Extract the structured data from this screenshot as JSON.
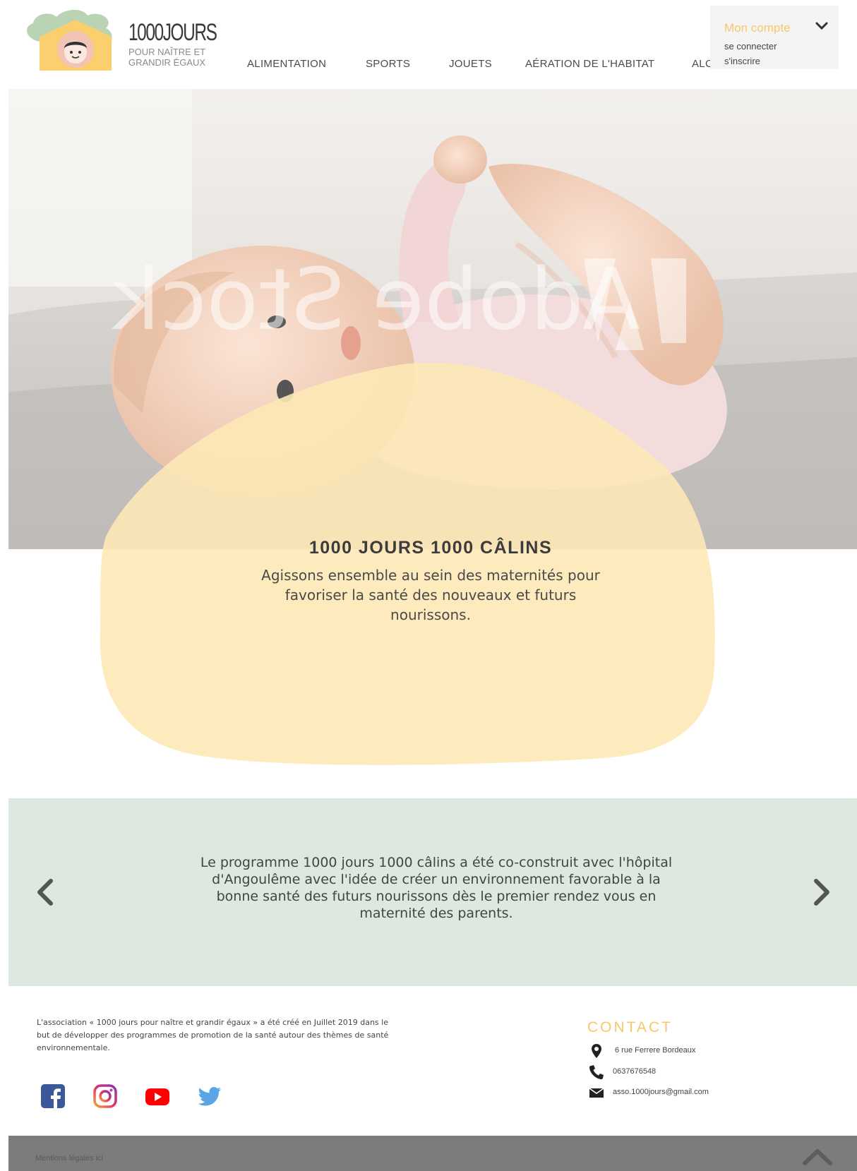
{
  "header": {
    "brand_title": "1000JOURS",
    "brand_sub_line1": "POUR NAÎTRE ET",
    "brand_sub_line2": "GRANDIR ÉGAUX",
    "nav": [
      {
        "label": "ALIMENTATION"
      },
      {
        "label": "SPORTS"
      },
      {
        "label": "JOUETS"
      },
      {
        "label": "AÉRATION DE L'HABITAT"
      },
      {
        "label": "ALCOOL"
      }
    ],
    "account": {
      "title": "Mon compte",
      "login": "se connecter",
      "signup": "s'inscrire"
    }
  },
  "hero": {
    "watermark": "Adobe Stock",
    "title": "1000 JOURS 1000 CÂLINS",
    "subtitle": "Agissons ensemble au sein des maternités pour favoriser la santé des nouveaux et futurs nourissons."
  },
  "carousel": {
    "text": "Le programme 1000 jours 1000 câlins a été co-construit avec l'hôpital d'Angoulême avec l'idée de créer un environnement favorable à la bonne santé des futurs nourissons dès le premier rendez vous en maternité des parents."
  },
  "footer": {
    "about": "L'association « 1000 jours pour naître et grandir égaux » a été créé en Juillet 2019 dans le but de développer des programmes de promotion de la santé autour des thèmes de santé environnementale.",
    "socials": [
      "facebook-icon",
      "instagram-icon",
      "youtube-icon",
      "twitter-icon"
    ],
    "contact": {
      "title": "CONTACT",
      "address": "6 rue Ferrere Bordeaux",
      "phone": "0637676548",
      "email": "asso.1000jours@gmail.com"
    },
    "legal": "Mentions légales ici"
  },
  "colors": {
    "accent_yellow": "#f7c86b",
    "blob_yellow": "#fde8b6",
    "carousel_bg": "#dde8df",
    "bottom_bar": "#7c7c7c"
  }
}
